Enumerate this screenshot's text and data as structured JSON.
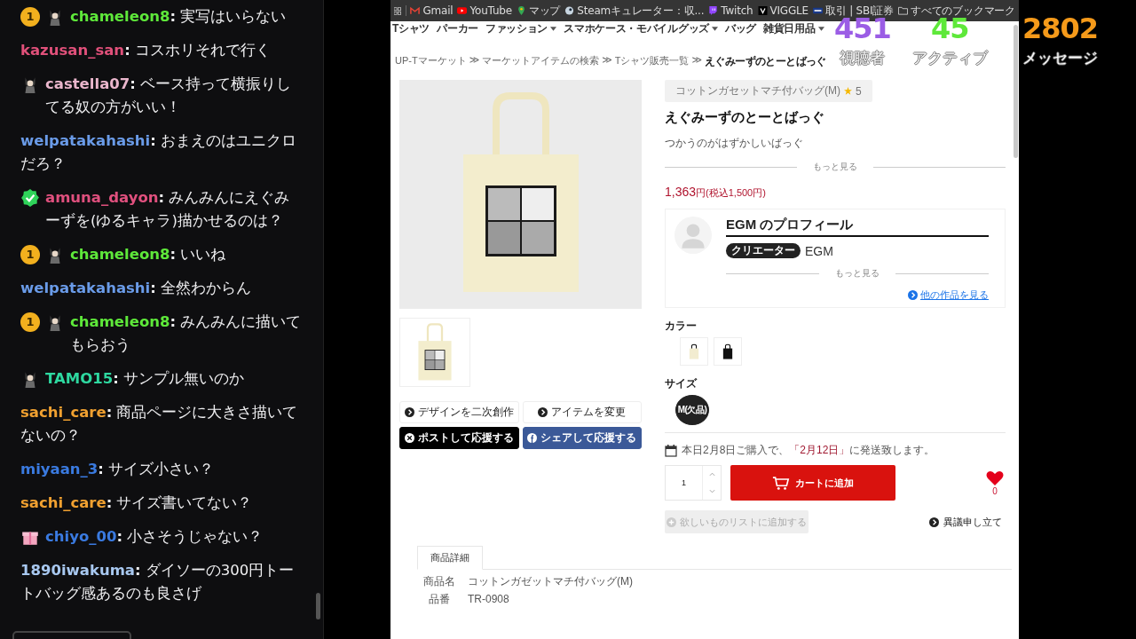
{
  "chat": {
    "messages": [
      {
        "badges": [
          {
            "kind": "sub",
            "label": "1"
          },
          {
            "kind": "avatar"
          }
        ],
        "user": "chameleon8",
        "delimiter": ":",
        "color": "#5ee83a",
        "text": "実写はいらない"
      },
      {
        "user": "kazusan_san",
        "delimiter": ":",
        "color": "#e0507a",
        "text": "コスホリそれで行く"
      },
      {
        "badges": [
          {
            "kind": "avatar"
          }
        ],
        "user": "castella07",
        "delimiter": ":",
        "color": "#eab6cc",
        "text": "ベース持って横振りしてる奴の方がいい！"
      },
      {
        "user": "welpatakahashi",
        "delimiter": ":",
        "color": "#6a9be8",
        "text": "おまえのはユニクロだろ？"
      },
      {
        "badges": [
          {
            "kind": "verified"
          }
        ],
        "user": "amuna_dayon",
        "delimiter": ":",
        "color": "#e0507e",
        "text": "みんみんにえぐみーずを(ゆるキャラ)描かせるのは？"
      },
      {
        "badges": [
          {
            "kind": "sub",
            "label": "1"
          },
          {
            "kind": "avatar"
          }
        ],
        "user": "chameleon8",
        "delimiter": ":",
        "color": "#5ee83a",
        "text": "いいね"
      },
      {
        "user": "welpatakahashi",
        "delimiter": ":",
        "color": "#6a9be8",
        "text": "全然わからん"
      },
      {
        "badges": [
          {
            "kind": "sub",
            "label": "1"
          },
          {
            "kind": "avatar"
          }
        ],
        "user": "chameleon8",
        "delimiter": ":",
        "color": "#5ee83a",
        "text": "みんみんに描いてもらおう"
      },
      {
        "badges": [
          {
            "kind": "avatar"
          }
        ],
        "user": "TAMO15",
        "delimiter": ":",
        "color": "#2ed8a0",
        "text": "サンプル無いのか"
      },
      {
        "user": "sachi_care",
        "delimiter": ":",
        "color": "#f0a030",
        "text": "商品ページに大きさ描いてないの？"
      },
      {
        "user": "miyaan_3",
        "delimiter": ":",
        "color": "#3a7ae0",
        "text": "サイズ小さい？"
      },
      {
        "user": "sachi_care",
        "delimiter": ":",
        "color": "#f0a030",
        "text": "サイズ書いてない？"
      },
      {
        "badges": [
          {
            "kind": "gift"
          }
        ],
        "user": "chiyo_00",
        "delimiter": ":",
        "color": "#3a7ae0",
        "text": "小さそうじゃない？"
      },
      {
        "user": "1890iwakuma",
        "delimiter": ":",
        "color": "#a8c8f0",
        "text": "ダイソーの300円トートバッグ感あるのも良さげ"
      }
    ]
  },
  "browser": {
    "bookmarks": [
      {
        "kind": "gmail",
        "label": "Gmail"
      },
      {
        "kind": "youtube",
        "label": "YouTube"
      },
      {
        "kind": "maps",
        "label": "マップ"
      },
      {
        "kind": "steam",
        "label": "Steamキュレーター：収..."
      },
      {
        "kind": "twitch",
        "label": "Twitch"
      },
      {
        "kind": "viggle",
        "label": "VIGGLE"
      },
      {
        "kind": "sbi",
        "label": "取引 | SBI証券"
      }
    ],
    "all_bookmarks": "すべてのブックマーク"
  },
  "site": {
    "nav": [
      {
        "label": "Tシャツ",
        "has_menu": false
      },
      {
        "label": "パーカー",
        "has_menu": false
      },
      {
        "label": "ファッション",
        "has_menu": true
      },
      {
        "label": "スマホケース・モバイルグッズ",
        "has_menu": true
      },
      {
        "label": "バッグ",
        "has_menu": false
      },
      {
        "label": "雑貨日用品",
        "has_menu": true
      }
    ],
    "breadcrumb": [
      {
        "label": "UP-Tマーケット",
        "separator": "≫",
        "current": false
      },
      {
        "label": "マーケットアイテムの検索",
        "separator": "≫",
        "current": false
      },
      {
        "label": "Tシャツ販売一覧",
        "separator": "≫",
        "current": false
      },
      {
        "label": "えぐみーずのとーとばっぐ",
        "current": true
      }
    ]
  },
  "product": {
    "actions": [
      {
        "kind": "secondary",
        "label": "デザインを二次創作"
      },
      {
        "kind": "secondary",
        "label": "アイテムを変更"
      },
      {
        "kind": "x",
        "label": "ポストして応援する"
      },
      {
        "kind": "facebook",
        "label": "シェアして応援する"
      }
    ],
    "category_tag": "コットンガセットマチ付バッグ(M)",
    "rating": "5",
    "title": "えぐみーずのとーとばっぐ",
    "description": "つかうのがはずかしいばっぐ",
    "more_label": "もっと見る",
    "price": "1,363",
    "price_suffix": "円(税込1,500円)",
    "profile": {
      "heading": "EGM のプロフィール",
      "role": "クリエーター",
      "name": "EGM",
      "more_label": "もっと見る",
      "link": "他の作品を見る"
    },
    "colors": {
      "label": "カラー",
      "options": [
        {
          "color": "#f2ecd0"
        },
        {
          "color": "#111111"
        }
      ]
    },
    "sizes": {
      "label": "サイズ",
      "options": [
        {
          "label": "M(欠品)",
          "selected": true
        }
      ]
    },
    "shipping": {
      "before": "本日2月8日ご購入で、",
      "date": "「2月12日」",
      "after": "に発送致します。"
    },
    "quantity": "1",
    "cart_button": "カートに追加",
    "likes": "0",
    "wishlist": {
      "label": "欲しいものリストに追加する",
      "disabled": true
    },
    "report": "異議申し立て",
    "details": {
      "tabs": [
        {
          "label": "商品詳細",
          "selected": true
        }
      ],
      "rows": [
        {
          "label": "商品名",
          "value": "コットンガゼットマチ付バッグ(M)"
        },
        {
          "label": "品番",
          "value": "TR-0908"
        }
      ]
    }
  },
  "stats": [
    {
      "value": "451",
      "label": "視聴者",
      "color": "#9b5de5"
    },
    {
      "value": "45",
      "label": "アクティブ",
      "color": "#5ee83a"
    },
    {
      "value": "2802",
      "label": "メッセージ",
      "color": "#f59a1a"
    }
  ]
}
